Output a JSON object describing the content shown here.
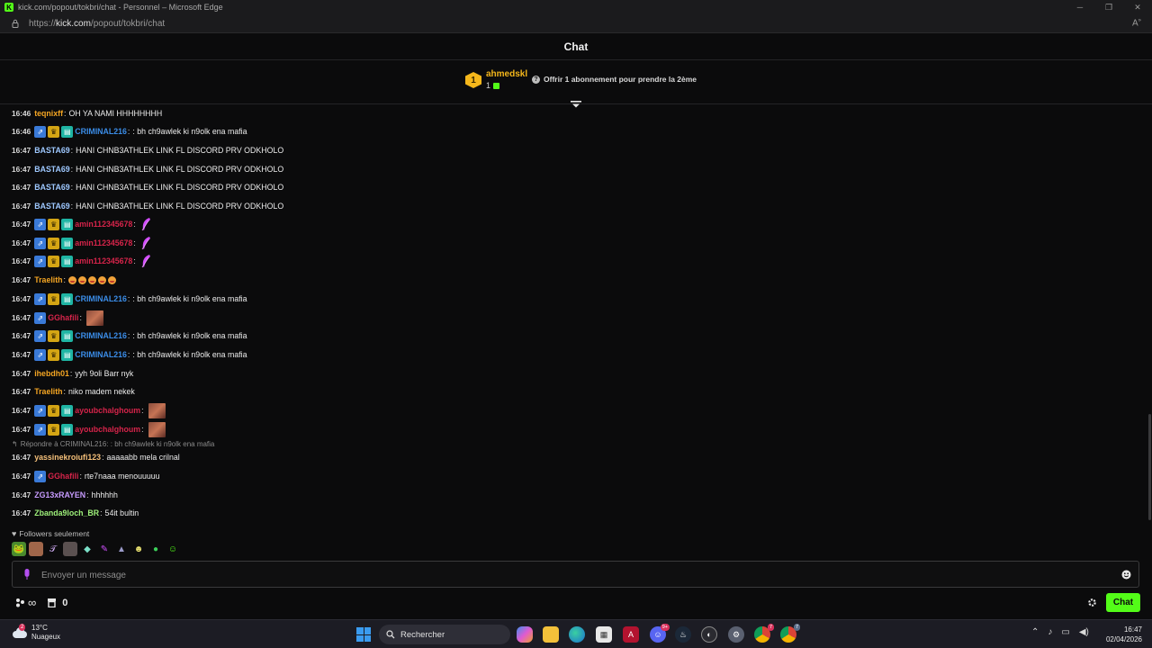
{
  "window": {
    "title": "kick.com/popout/tokbri/chat - Personnel – Microsoft Edge",
    "url_prefix": "https://",
    "url_host": "kick.com",
    "url_path": "/popout/tokbri/chat"
  },
  "chat": {
    "title": "Chat"
  },
  "pinned": {
    "rank": "1",
    "gifter": "ahmedskl",
    "count": "1",
    "offer_icon": "?",
    "offer_text": "Offrir 1 abonnement pour prendre la 2ème"
  },
  "messages": [
    {
      "time": "16:46",
      "badges": [],
      "user": "teqnixff",
      "color": "#f5a623",
      "text": "OH YA NAMI HHHHHHHH"
    },
    {
      "time": "16:46",
      "badges": [
        "b1",
        "b2",
        "b3"
      ],
      "user": "CRIMINAL216",
      "color": "#3b8de8",
      "text": ": bh ch9awlek ki n9olk ena mafia"
    },
    {
      "time": "16:47",
      "badges": [],
      "user": "BASTA69",
      "color": "#9ec8ff",
      "text": "HANI CHNB3ATHLEK LINK FL DISCORD PRV ODKHOLO"
    },
    {
      "time": "16:47",
      "badges": [],
      "user": "BASTA69",
      "color": "#9ec8ff",
      "text": "HANI CHNB3ATHLEK LINK FL DISCORD PRV ODKHOLO"
    },
    {
      "time": "16:47",
      "badges": [],
      "user": "BASTA69",
      "color": "#9ec8ff",
      "text": "HANI CHNB3ATHLEK LINK FL DISCORD PRV ODKHOLO"
    },
    {
      "time": "16:47",
      "badges": [],
      "user": "BASTA69",
      "color": "#9ec8ff",
      "text": "HANI CHNB3ATHLEK LINK FL DISCORD PRV ODKHOLO"
    },
    {
      "time": "16:47",
      "badges": [
        "b1",
        "b2",
        "b3"
      ],
      "user": "amin112345678",
      "color": "#d6244a",
      "text": "",
      "emote": "feather"
    },
    {
      "time": "16:47",
      "badges": [
        "b1",
        "b2",
        "b3"
      ],
      "user": "amin112345678",
      "color": "#d6244a",
      "text": "",
      "emote": "feather"
    },
    {
      "time": "16:47",
      "badges": [
        "b1",
        "b2",
        "b3"
      ],
      "user": "amin112345678",
      "color": "#d6244a",
      "text": "",
      "emote": "feather"
    },
    {
      "time": "16:47",
      "badges": [],
      "user": "Traelith",
      "color": "#f5a623",
      "text": "",
      "emoji_count": 5
    },
    {
      "time": "16:47",
      "badges": [
        "b1",
        "b2",
        "b3"
      ],
      "user": "CRIMINAL216",
      "color": "#3b8de8",
      "text": ": bh ch9awlek ki n9olk ena mafia"
    },
    {
      "time": "16:47",
      "badges": [
        "b1"
      ],
      "user": "GGhafili",
      "color": "#d6244a",
      "text": "",
      "emote": "image"
    },
    {
      "time": "16:47",
      "badges": [
        "b1",
        "b2",
        "b3"
      ],
      "user": "CRIMINAL216",
      "color": "#3b8de8",
      "text": ": bh ch9awlek ki n9olk ena mafia"
    },
    {
      "time": "16:47",
      "badges": [
        "b1",
        "b2",
        "b3"
      ],
      "user": "CRIMINAL216",
      "color": "#3b8de8",
      "text": ": bh ch9awlek ki n9olk ena mafia"
    },
    {
      "time": "16:47",
      "badges": [],
      "user": "ihebdh01",
      "color": "#f5a623",
      "text": "yyh 9oli Barr nyk"
    },
    {
      "time": "16:47",
      "badges": [],
      "user": "Traelith",
      "color": "#f5a623",
      "text": "niko madem nekek"
    },
    {
      "time": "16:47",
      "badges": [
        "b1",
        "b2",
        "b3"
      ],
      "user": "ayoubchalghoum",
      "color": "#d6244a",
      "text": "",
      "emote": "image"
    },
    {
      "time": "16:47",
      "badges": [
        "b1",
        "b2",
        "b3"
      ],
      "user": "ayoubchalghoum",
      "color": "#d6244a",
      "text": "",
      "emote": "image"
    },
    {
      "time": "16:47",
      "badges": [],
      "user": "yassinekroiufi123",
      "color": "#f5c07a",
      "text": "aaaaabb mela crilnal",
      "reply": "Répondre à CRIMINAL216: : bh ch9awlek ki n9olk ena mafia"
    },
    {
      "time": "16:47",
      "badges": [
        "b1"
      ],
      "user": "GGhafili",
      "color": "#d6244a",
      "text": "rte7naaa menouuuuu"
    },
    {
      "time": "16:47",
      "badges": [],
      "user": "ZG13xRAYEN",
      "color": "#c79bff",
      "text": "hhhhhh"
    },
    {
      "time": "16:47",
      "badges": [],
      "user": "Zbanda9loch_BR",
      "color": "#9ef07a",
      "text": "54it bultin"
    }
  ],
  "followers_label": "Followers seulement",
  "input": {
    "placeholder": "Envoyer un message"
  },
  "toolbar": {
    "infinity": "∞",
    "gift_count": "0",
    "chat_button": "Chat"
  },
  "taskbar": {
    "temp": "13°C",
    "condition": "Nuageux",
    "weather_badge": "2",
    "search_placeholder": "Rechercher",
    "time": "16:47",
    "date": "02/04/2026",
    "discord_badge": "9+",
    "chrome_badge": "7",
    "chrome2_badge": "7"
  },
  "colors": {
    "accent": "#53fc18",
    "background": "#0b0b0c",
    "gold": "#f5b71b"
  }
}
